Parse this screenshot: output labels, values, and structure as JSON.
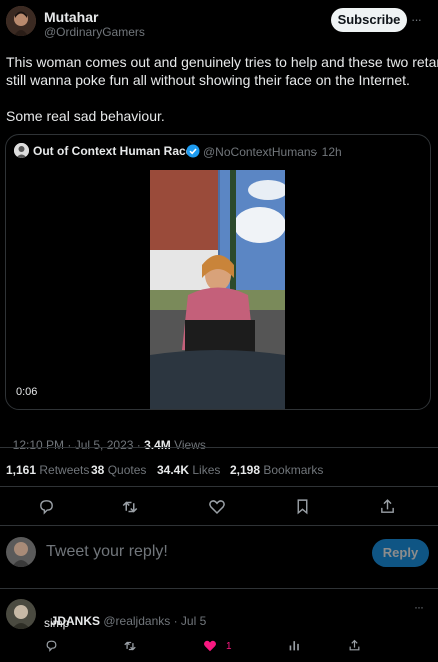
{
  "tweet": {
    "author_name": "Mutahar",
    "author_handle": "@OrdinaryGamers",
    "subscribe_label": "Subscribe",
    "more_label": "···",
    "text_line1": "This woman comes out and genuinely tries to help and these two retards",
    "text_line2": "still wanna poke fun all without showing their face on the Internet.",
    "text_line3": "Some real sad behaviour.",
    "timestamp": "12:10 PM · Jul 5, 2023 · ",
    "views_count": "3.4M",
    "views_label": " Views"
  },
  "quote": {
    "author_name": "Out of Context Human Race",
    "author_handle": "@NoContextHumans",
    "time": " · 12h",
    "video_duration": "0:06"
  },
  "stats": {
    "retweets_count": "1,161",
    "retweets_label": " Retweets",
    "quotes_count": "38",
    "quotes_label": " Quotes",
    "likes_count": "34.4K",
    "likes_label": " Likes",
    "bookmarks_count": "2,198",
    "bookmarks_label": " Bookmarks"
  },
  "composer": {
    "placeholder": "Tweet your reply!",
    "reply_label": "Reply"
  },
  "reply": {
    "author_name": "JDANKS",
    "author_handle": "@realjdanks",
    "time": " · Jul 5",
    "text": "simp",
    "likes_count": "1",
    "more_label": "···"
  },
  "colors": {
    "accent": "#1d9bf0",
    "like_active": "#f91880",
    "verified": "#1d9bf0"
  }
}
